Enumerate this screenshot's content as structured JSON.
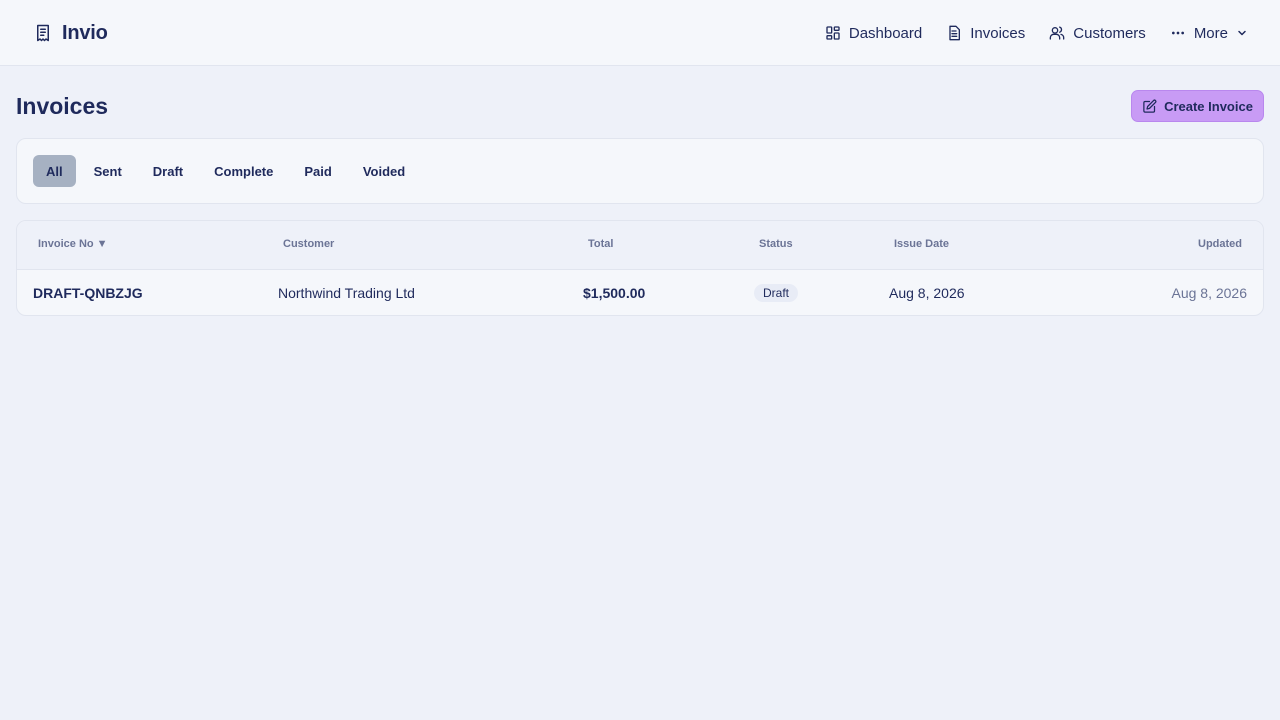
{
  "app": {
    "name": "Invio"
  },
  "nav": {
    "dashboard": "Dashboard",
    "invoices": "Invoices",
    "customers": "Customers",
    "more": "More"
  },
  "page": {
    "title": "Invoices",
    "create_button": "Create Invoice"
  },
  "filters": {
    "active": "All",
    "tabs": [
      "All",
      "Sent",
      "Draft",
      "Complete",
      "Paid",
      "Voided"
    ]
  },
  "table": {
    "columns": {
      "invoice_no": "Invoice No ▼",
      "customer": "Customer",
      "total": "Total",
      "status": "Status",
      "issue_date": "Issue Date",
      "updated": "Updated"
    },
    "rows": [
      {
        "invoice_no": "DRAFT-QNBZJG",
        "customer": "Northwind Trading Ltd",
        "total": "$1,500.00",
        "status": "Draft",
        "issue_date": "Aug 8, 2026",
        "updated": "Aug 8, 2026"
      }
    ]
  },
  "icons": {
    "brand": "receipt-icon",
    "dashboard": "layout-grid-icon",
    "invoices": "document-icon",
    "customers": "users-icon",
    "more": "dots-horizontal-icon",
    "more_caret": "chevron-down-icon",
    "create": "edit-icon"
  },
  "colors": {
    "accent": "#c89bf5",
    "active_filter": "#a6b1c2",
    "text": "#1f2a5c",
    "background": "#eef1f9"
  }
}
